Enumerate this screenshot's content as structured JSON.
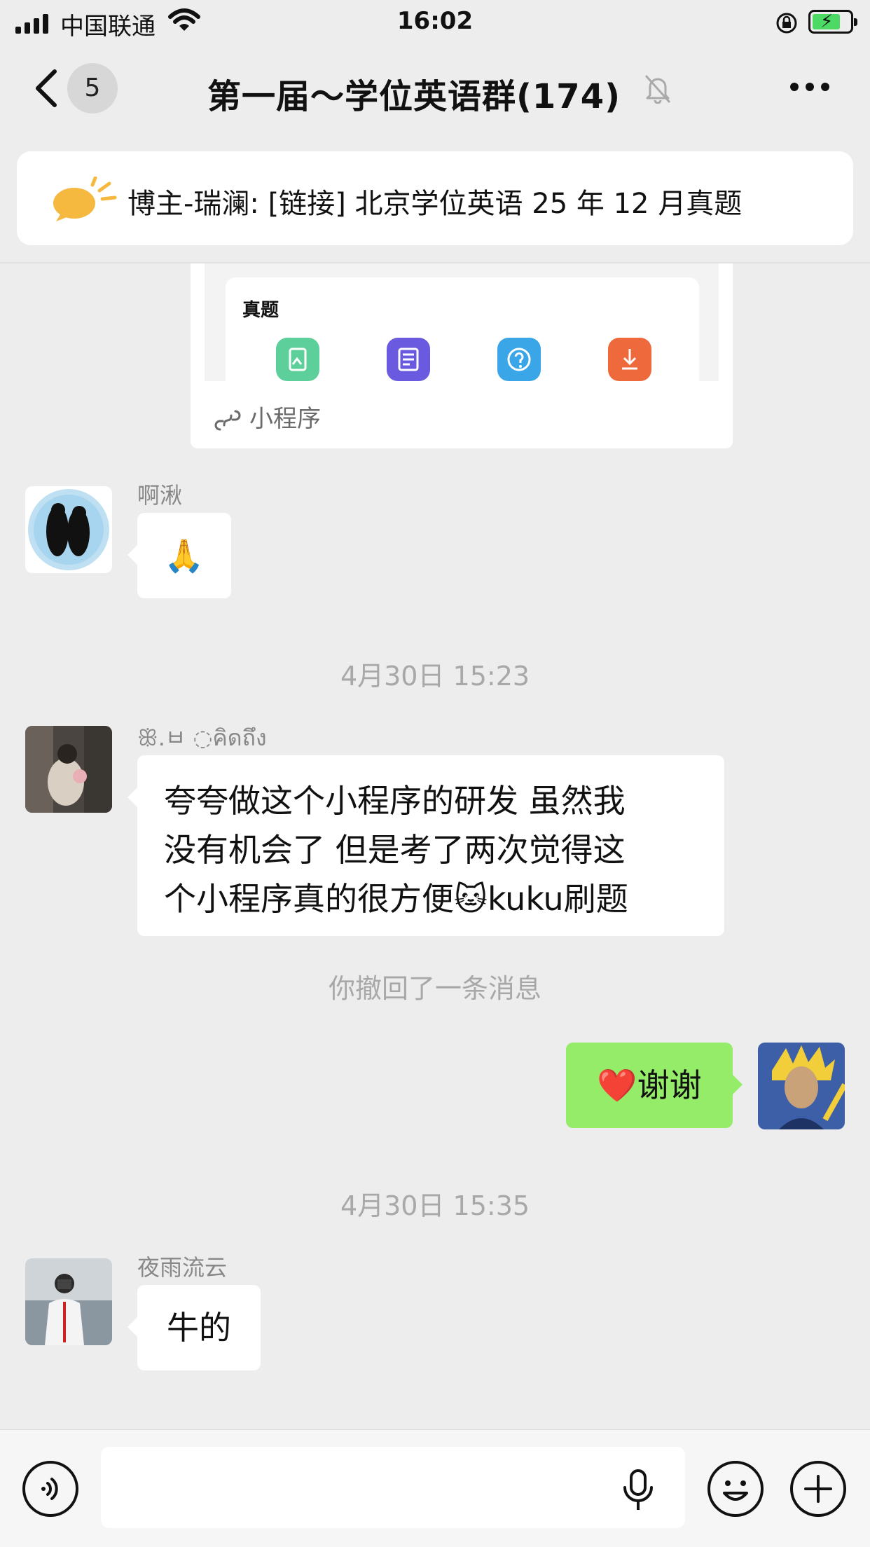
{
  "status_bar": {
    "carrier": "中国联通",
    "time": "16:02",
    "battery_level": 0.75,
    "charging": true
  },
  "nav": {
    "back_icon": "chevron-left-icon",
    "unread_count": "5",
    "title": "第一届～学位英语群(174)",
    "mute_icon": "bell-muted-icon",
    "more_icon": "more-dots-icon"
  },
  "pinned": {
    "icon": "announcement-bubble-icon",
    "text": "博主-瑞澜: [链接] 北京学位英语 25 年 12 月真题"
  },
  "mini_program_card": {
    "section_title": "真题",
    "tiles": [
      {
        "icon": "document-icon",
        "color": "#5ccf9a"
      },
      {
        "icon": "list-icon",
        "color": "#6a5ae0"
      },
      {
        "icon": "help-icon",
        "color": "#3aa6e8"
      },
      {
        "icon": "download-icon",
        "color": "#ee6a3c"
      }
    ],
    "footer_label": "小程序"
  },
  "messages": [
    {
      "sender": "啊湫",
      "content": "🙏"
    },
    {
      "time": "4月30日 15:23"
    },
    {
      "sender": "ꕥ.ㅂ ◌ค‌ิดถึง",
      "lines": [
        "夸夸做这个小程序的研发   虽然我",
        "没有机会了  但是考了两次觉得这",
        "个小程序真的很方便🐱kuku刷题"
      ]
    },
    {
      "system": "你撤回了一条消息"
    },
    {
      "mine": true,
      "content": "❤️谢谢"
    },
    {
      "time": "4月30日 15:35"
    },
    {
      "sender": "夜雨流云",
      "content": "牛的"
    }
  ],
  "input_bar": {
    "voice_icon": "voice-mode-icon",
    "mic_icon": "microphone-icon",
    "emoji_icon": "emoji-icon",
    "plus_icon": "plus-icon",
    "placeholder": ""
  },
  "colors": {
    "background": "#ededed",
    "my_bubble": "#95ec69",
    "other_bubble": "#ffffff",
    "timestamp": "#a8a8a8"
  }
}
